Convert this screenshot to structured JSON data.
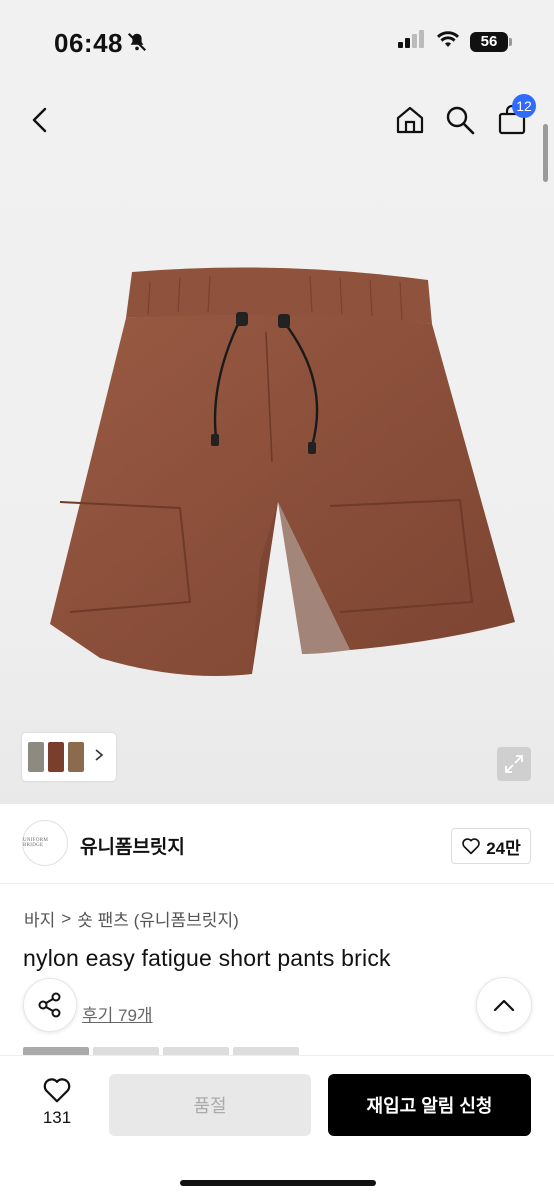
{
  "status_bar": {
    "time": "06:48",
    "battery": "56"
  },
  "nav": {
    "cart_count": "12"
  },
  "brand": {
    "logo_text": "UNIFORM BRIDGE",
    "name": "유니폼브릿지",
    "like_count": "24만"
  },
  "breadcrumb": {
    "category": "바지",
    "separator": ">",
    "subcategory": "숏 팬츠 (유니폼브릿지)"
  },
  "product": {
    "title": "nylon easy fatigue short pants brick",
    "review_link": "후기 79개",
    "color_accent": "#8a4f3a"
  },
  "bottom_bar": {
    "wish_count": "131",
    "soldout_label": "품절",
    "restock_label": "재입고 알림 신청"
  }
}
